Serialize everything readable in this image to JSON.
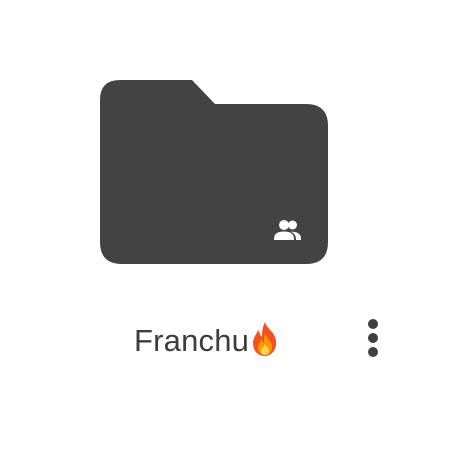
{
  "folder": {
    "name": "Franchu",
    "name_emoji": "fire",
    "shared": true,
    "icon": "shared-folder-icon",
    "color": "#424342"
  },
  "actions": {
    "more_icon": "more-vert-icon"
  }
}
